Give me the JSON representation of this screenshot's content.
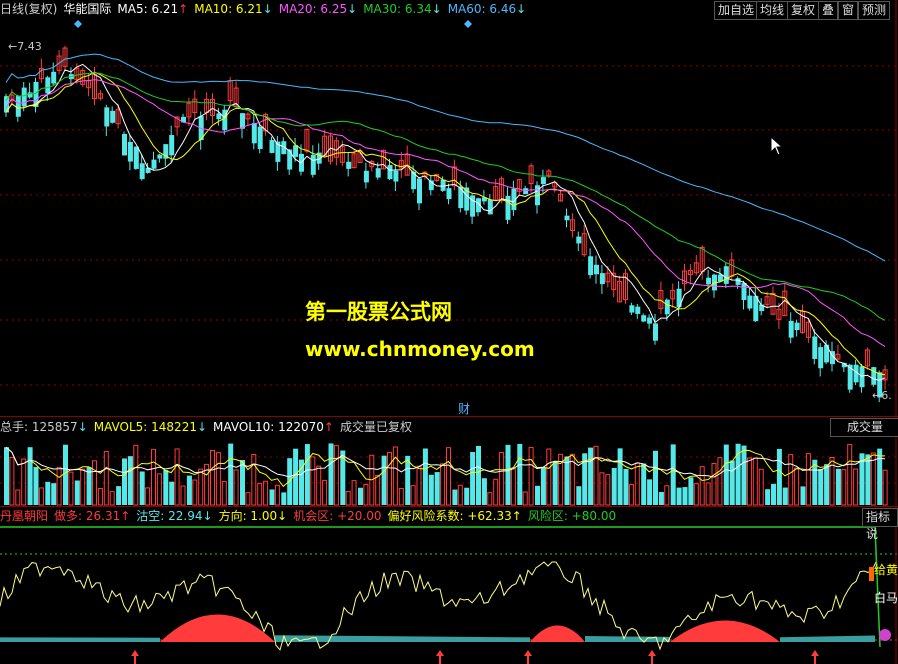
{
  "colors": {
    "up": "#ff3b3b",
    "down": "#55e8e8",
    "ma5": "#ffffff",
    "ma10": "#ffff00",
    "ma20": "#ff55ff",
    "ma30": "#22cc22",
    "ma60": "#4ab8ff",
    "grid": "#8b0000"
  },
  "main": {
    "period": "日线(复权)",
    "stock": "华能国际",
    "ma5": {
      "label": "MA5: 6.21",
      "arrow": "↑"
    },
    "ma10": {
      "label": "MA10: 6.21",
      "arrow": "↓"
    },
    "ma20": {
      "label": "MA20: 6.25",
      "arrow": "↓"
    },
    "ma30": {
      "label": "MA30: 6.34",
      "arrow": "↓"
    },
    "ma60": {
      "label": "MA60: 6.46",
      "arrow": "↓"
    },
    "high_label": "7.43",
    "low_label": "6.",
    "cai_marker": "财",
    "buttons": [
      "加自选",
      "均线",
      "复权",
      "叠",
      "窗",
      "预测"
    ]
  },
  "watermark": {
    "title": "第一股票公式网",
    "url": "www.chnmoney.com"
  },
  "volume": {
    "total": "总手: 125857",
    "total_arrow": "↓",
    "mavol5": "MAVOL5: 148221",
    "mavol5_arrow": "↓",
    "mavol10": "MAVOL10: 122070",
    "mavol10_arrow": "↑",
    "note": "成交量已复权",
    "button": "成交量"
  },
  "indicator": {
    "name": "丹凰朝阳",
    "duo": "做多: 26.31↑",
    "kong": "沽空: 22.94↓",
    "fx": "方向: 1.00↓",
    "jh": "机会区: +20.00",
    "pf": "偏好风险系数: +62.33↑",
    "fxq": "风险区: +80.00",
    "button": "指标说",
    "side1": "给黄",
    "side2": "白马"
  }
}
